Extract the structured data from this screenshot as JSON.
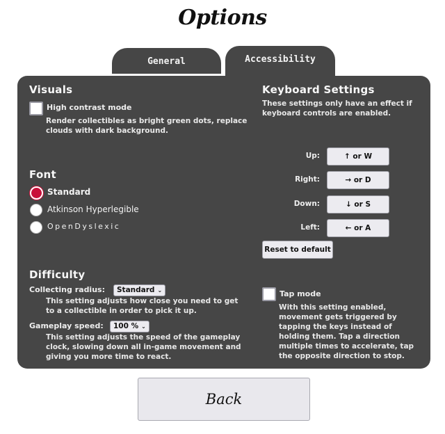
{
  "page": {
    "title": "Options"
  },
  "tabs": [
    {
      "label": "General",
      "active": false
    },
    {
      "label": "Accessibility",
      "active": true
    }
  ],
  "visuals": {
    "heading": "Visuals",
    "high_contrast": {
      "label": "High contrast mode",
      "checked": false,
      "description_line1": "Render collectibles as bright green dots, replace",
      "description_line2": "clouds with dark background."
    }
  },
  "font": {
    "heading": "Font",
    "options": [
      {
        "label": "Standard",
        "selected": true
      },
      {
        "label": "Atkinson Hyperlegible",
        "selected": false
      },
      {
        "label": "OpenDyslexic",
        "selected": false
      }
    ]
  },
  "difficulty": {
    "heading": "Difficulty",
    "collecting_radius": {
      "label": "Collecting radius:",
      "value": "Standard",
      "description_line1": "This setting adjusts how close you need to get",
      "description_line2": "to a collectible in order to pick it up."
    },
    "gameplay_speed": {
      "label": "Gameplay speed:",
      "value": "100 %",
      "description_line1": "This setting adjusts the speed of the gameplay",
      "description_line2": "clock, slowing down all in-game movement and",
      "description_line3": "giving you more time to react."
    }
  },
  "keyboard": {
    "heading": "Keyboard Settings",
    "note_line1": "These settings only have an effect if",
    "note_line2": "keyboard controls are enabled.",
    "bindings": [
      {
        "label": "Up:",
        "key": "↑ or W"
      },
      {
        "label": "Right:",
        "key": "→ or D"
      },
      {
        "label": "Down:",
        "key": "↓ or S"
      },
      {
        "label": "Left:",
        "key": "← or A"
      }
    ],
    "reset_label": "Reset to default",
    "tap_mode": {
      "label": "Tap mode",
      "checked": false,
      "description_lines": [
        "With this setting enabled,",
        "movement gets triggered by",
        "tapping the keys instead of",
        "holding them. Tap a direction",
        "multiple times to accelerate, tap",
        "the opposite direction to stop."
      ]
    }
  },
  "footer": {
    "back_label": "Back"
  },
  "colors": {
    "panel_bg": "#464646",
    "radio_selected": "#c8103a",
    "button_bg": "#ecebf0"
  }
}
